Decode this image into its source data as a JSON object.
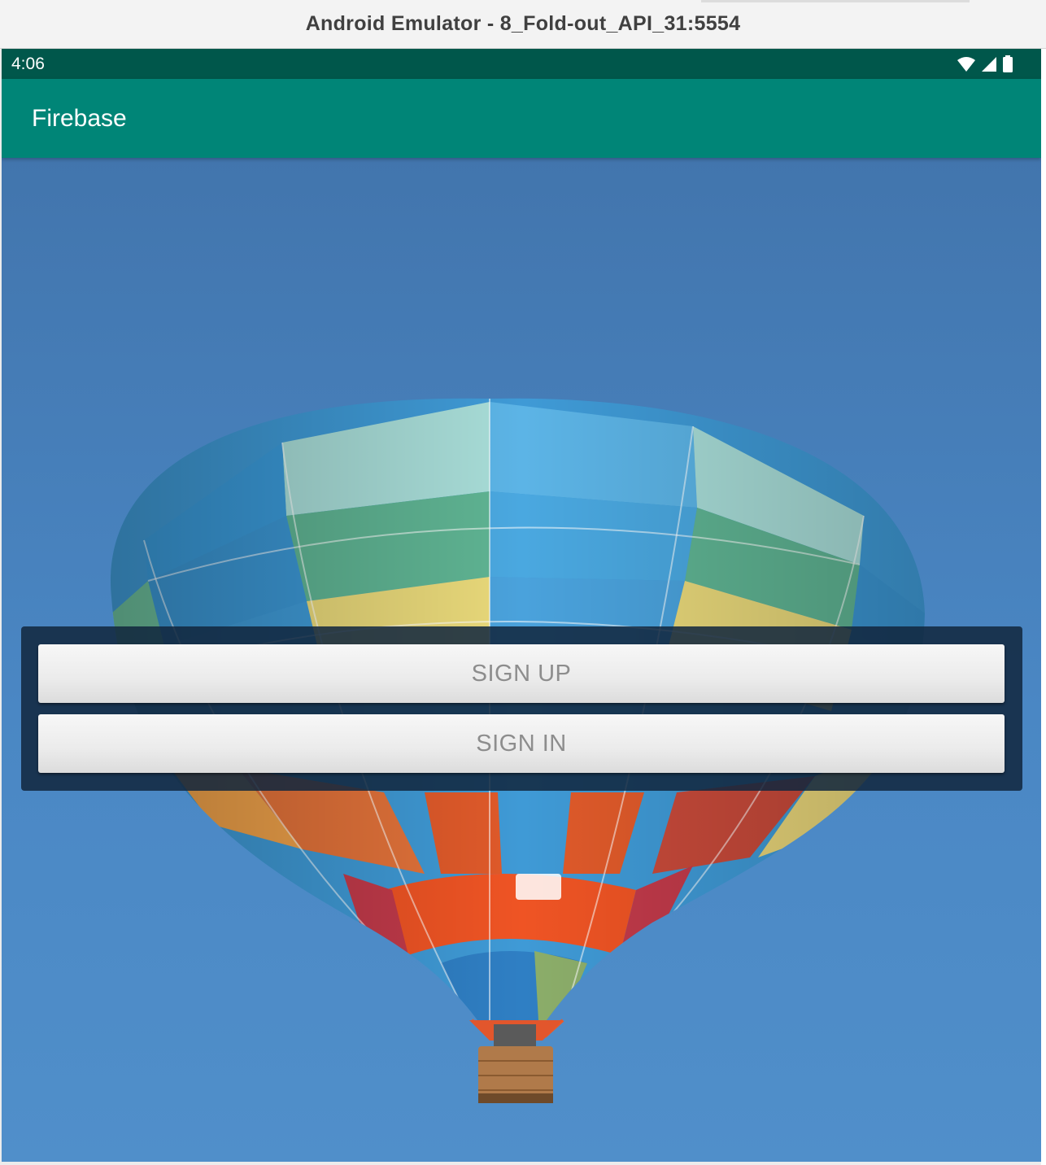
{
  "window": {
    "title": "Android Emulator - 8_Fold-out_API_31:5554"
  },
  "status_bar": {
    "time": "4:06",
    "icons": [
      "wifi-icon",
      "signal-icon",
      "battery-icon"
    ]
  },
  "app_bar": {
    "title": "Firebase",
    "color": "#008577",
    "status_color": "#00574b"
  },
  "background": {
    "image": "hot-air-balloon",
    "sky_color": "#4a87c4"
  },
  "actions": {
    "sign_up_label": "SIGN UP",
    "sign_in_label": "SIGN IN"
  }
}
